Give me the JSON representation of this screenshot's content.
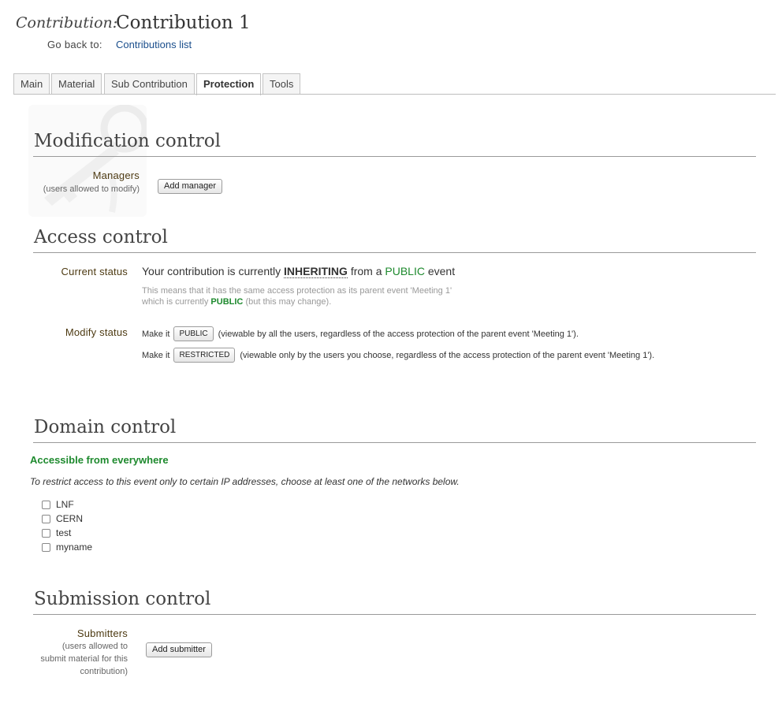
{
  "header": {
    "label": "Contribution:",
    "title": "Contribution 1",
    "go_back_label": "Go back to:",
    "go_back_link": "Contributions list"
  },
  "tabs": [
    {
      "label": "Main",
      "active": false
    },
    {
      "label": "Material",
      "active": false
    },
    {
      "label": "Sub Contribution",
      "active": false
    },
    {
      "label": "Protection",
      "active": true
    },
    {
      "label": "Tools",
      "active": false
    }
  ],
  "modification": {
    "title": "Modification control",
    "managers_label": "Managers",
    "managers_sub": "(users allowed to modify)",
    "add_manager": "Add manager",
    "watermark_icon": "key-icon"
  },
  "access": {
    "title": "Access control",
    "current_status_label": "Current status",
    "status_prefix": "Your contribution is currently",
    "status_state": "INHERITING",
    "status_mid": "from a",
    "status_parent": "PUBLIC",
    "status_suffix": "event",
    "note_line1": "This means that it has the same access protection as its parent event 'Meeting 1'",
    "note_line2_prefix": "which is currently",
    "note_line2_state": "PUBLIC",
    "note_line2_suffix": "(but this may change).",
    "modify_status_label": "Modify status",
    "make_it": "Make it",
    "public_button": "PUBLIC",
    "public_desc": "(viewable by all the users, regardless of the access protection of the parent event 'Meeting 1').",
    "restricted_button": "RESTRICTED",
    "restricted_desc": "(viewable only by the users you choose, regardless of the access protection of the parent event 'Meeting 1')."
  },
  "domain": {
    "title": "Domain control",
    "accessible": "Accessible from everywhere",
    "instructions": "To restrict access to this event only to certain IP addresses, choose at least one of the networks below.",
    "networks": [
      "LNF",
      "CERN",
      "test",
      "myname"
    ]
  },
  "submission": {
    "title": "Submission control",
    "submitters_label": "Submitters",
    "submitters_sub_1": "(users allowed to",
    "submitters_sub_2": "submit material for this",
    "submitters_sub_3": "contribution)",
    "add_submitter": "Add submitter"
  },
  "colors": {
    "green": "#1e8a2e",
    "link": "#1a4e8c"
  }
}
